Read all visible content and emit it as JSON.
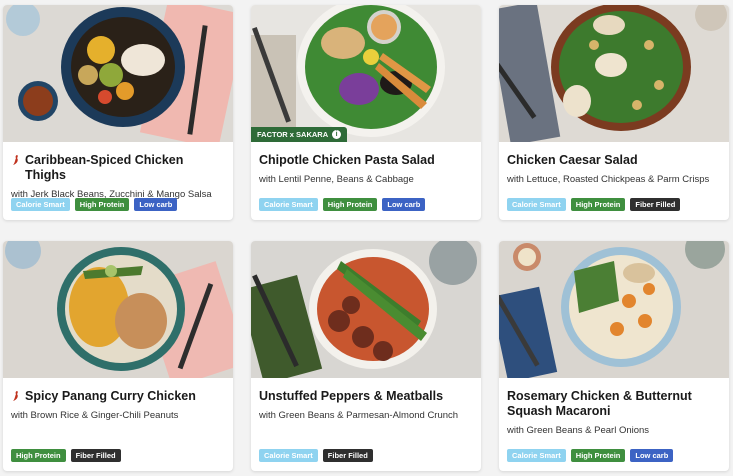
{
  "tag_colors": {
    "Calorie Smart": "#8fd3f0",
    "High Protein": "#3f8f3f",
    "Low carb": "#3c63c4",
    "Fiber Filled": "#2f2f2f"
  },
  "meals": [
    {
      "title": "Caribbean-Spiced Chicken Thighs",
      "subtitle": "with Jerk Black Beans, Zucchini & Mango Salsa",
      "spicy": true,
      "tags": [
        "Calorie Smart",
        "High Protein",
        "Low carb"
      ]
    },
    {
      "title": "Chipotle Chicken Pasta Salad",
      "subtitle": "with Lentil Penne, Beans & Cabbage",
      "spicy": false,
      "badge": "FACTOR x SAKARA",
      "tags": [
        "Calorie Smart",
        "High Protein",
        "Low carb"
      ]
    },
    {
      "title": "Chicken Caesar Salad",
      "subtitle": "with Lettuce, Roasted Chickpeas & Parm Crisps",
      "spicy": false,
      "tags": [
        "Calorie Smart",
        "High Protein",
        "Fiber Filled"
      ]
    },
    {
      "title": "Spicy Panang Curry Chicken",
      "subtitle": "with Brown Rice & Ginger-Chili Peanuts",
      "spicy": true,
      "tags": [
        "High Protein",
        "Fiber Filled"
      ]
    },
    {
      "title": "Unstuffed Peppers & Meatballs",
      "subtitle": "with Green Beans & Parmesan-Almond Crunch",
      "spicy": false,
      "tags": [
        "Calorie Smart",
        "Fiber Filled"
      ]
    },
    {
      "title": "Rosemary Chicken & Butternut Squash Macaroni",
      "subtitle": "with Green Beans & Pearl Onions",
      "spicy": false,
      "tags": [
        "Calorie Smart",
        "High Protein",
        "Low carb"
      ]
    }
  ]
}
